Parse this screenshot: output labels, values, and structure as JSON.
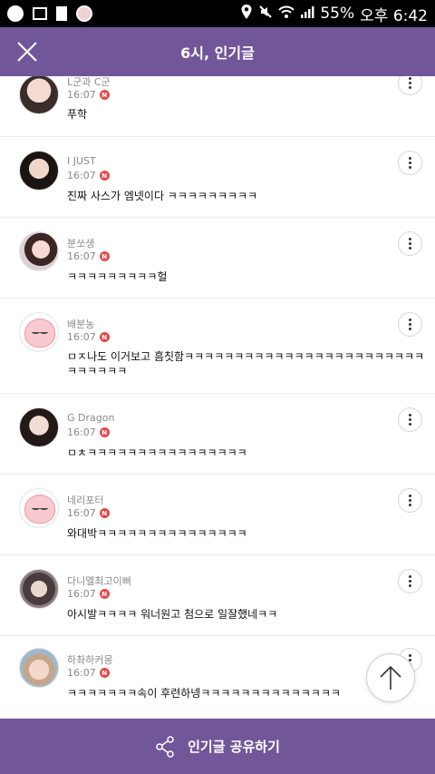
{
  "status_bar": {
    "battery": "55%",
    "time": "오후 6:42",
    "icons": [
      "app-icon",
      "gallery-icon",
      "document-icon",
      "avatar-icon",
      "location-icon",
      "mute-icon",
      "wifi-icon",
      "signal-icon"
    ]
  },
  "header": {
    "title": "6시, 인기글",
    "close_icon": "close-icon"
  },
  "comments": [
    {
      "nickname": "L군과 C군",
      "time": "16:07",
      "badge": "N",
      "text": "푸학"
    },
    {
      "nickname": "I JUST",
      "time": "16:07",
      "badge": "N",
      "text": "진짜 사스가 엠넷이다 ㅋㅋㅋㅋㅋㅋㅋㅋㅋ"
    },
    {
      "nickname": "분쏘생",
      "time": "16:07",
      "badge": "N",
      "text": "ㅋㅋㅋㅋㅋㅋㅋㅋㅋ헐"
    },
    {
      "nickname": "배분농",
      "time": "16:07",
      "badge": "N",
      "text": "ㅁㅈ나도 이거보고 흠칫함ㅋㅋㅋㅋㅋㅋㅋㅋㅋㅋㅋㅋㅋㅋㅋㅋㅋㅋㅋㅋㅋㅋㅋㅋㅋㅋㅋㅋㅋㅋ"
    },
    {
      "nickname": "G Dragon",
      "time": "16:07",
      "badge": "N",
      "text": "ㅁㅊㅋㅋㅋㅋㅋㅋㅋㅋㅋㅋㅋㅋㅋㅋㅋㅋ"
    },
    {
      "nickname": "네리포터",
      "time": "16:07",
      "badge": "N",
      "text": "와대박ㅋㅋㅋㅋㅋㅋㅋㅋㅋㅋㅋㅋㅋㅋㅋ"
    },
    {
      "nickname": "다니엘최고이뻐",
      "time": "16:07",
      "badge": "N",
      "text": "아시발ㅋㅋㅋㅋ 워너원고 첨으로 일잘했네ㅋㅋ"
    },
    {
      "nickname": "하촤하커몽",
      "time": "16:07",
      "badge": "N",
      "text": "ㅋㅋㅋㅋㅋㅋㅋ속이 후련하넹ㅋㅋㅋㅋㅋㅋㅋㅋㅋㅋㅋㅋㅋㅋ"
    }
  ],
  "footer": {
    "share_label": "인기글 공유하기",
    "share_icon": "share-icon"
  },
  "colors": {
    "brand_purple": "#71569a",
    "new_badge": "#e44a4a"
  }
}
